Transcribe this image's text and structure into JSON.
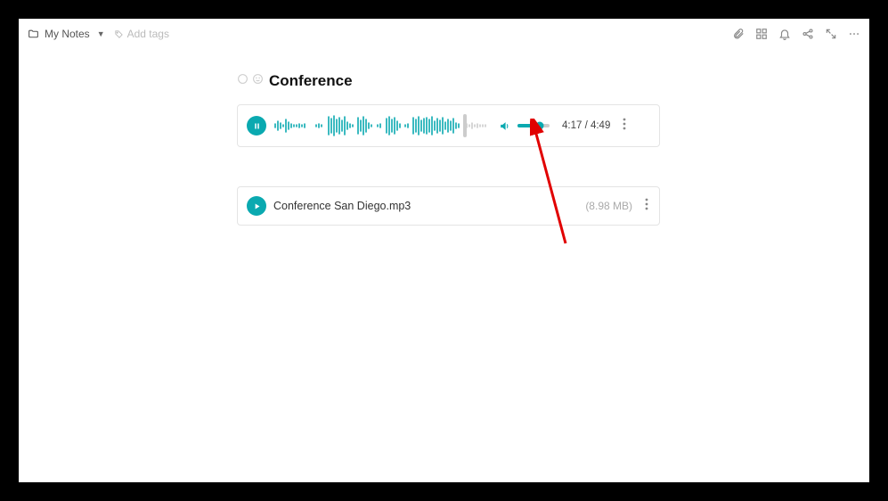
{
  "header": {
    "folder_label": "My Notes",
    "add_tags_placeholder": "Add tags"
  },
  "note": {
    "title": "Conference"
  },
  "audio": {
    "current_time": "4:17",
    "total_time": "4:49",
    "time_display": "4:17 / 4:49",
    "progress_fraction": 0.87,
    "volume_fraction": 0.7
  },
  "attachment": {
    "filename": "Conference San Diego.mp3",
    "size": "(8.98 MB)"
  },
  "colors": {
    "accent": "#0aa9b0"
  }
}
